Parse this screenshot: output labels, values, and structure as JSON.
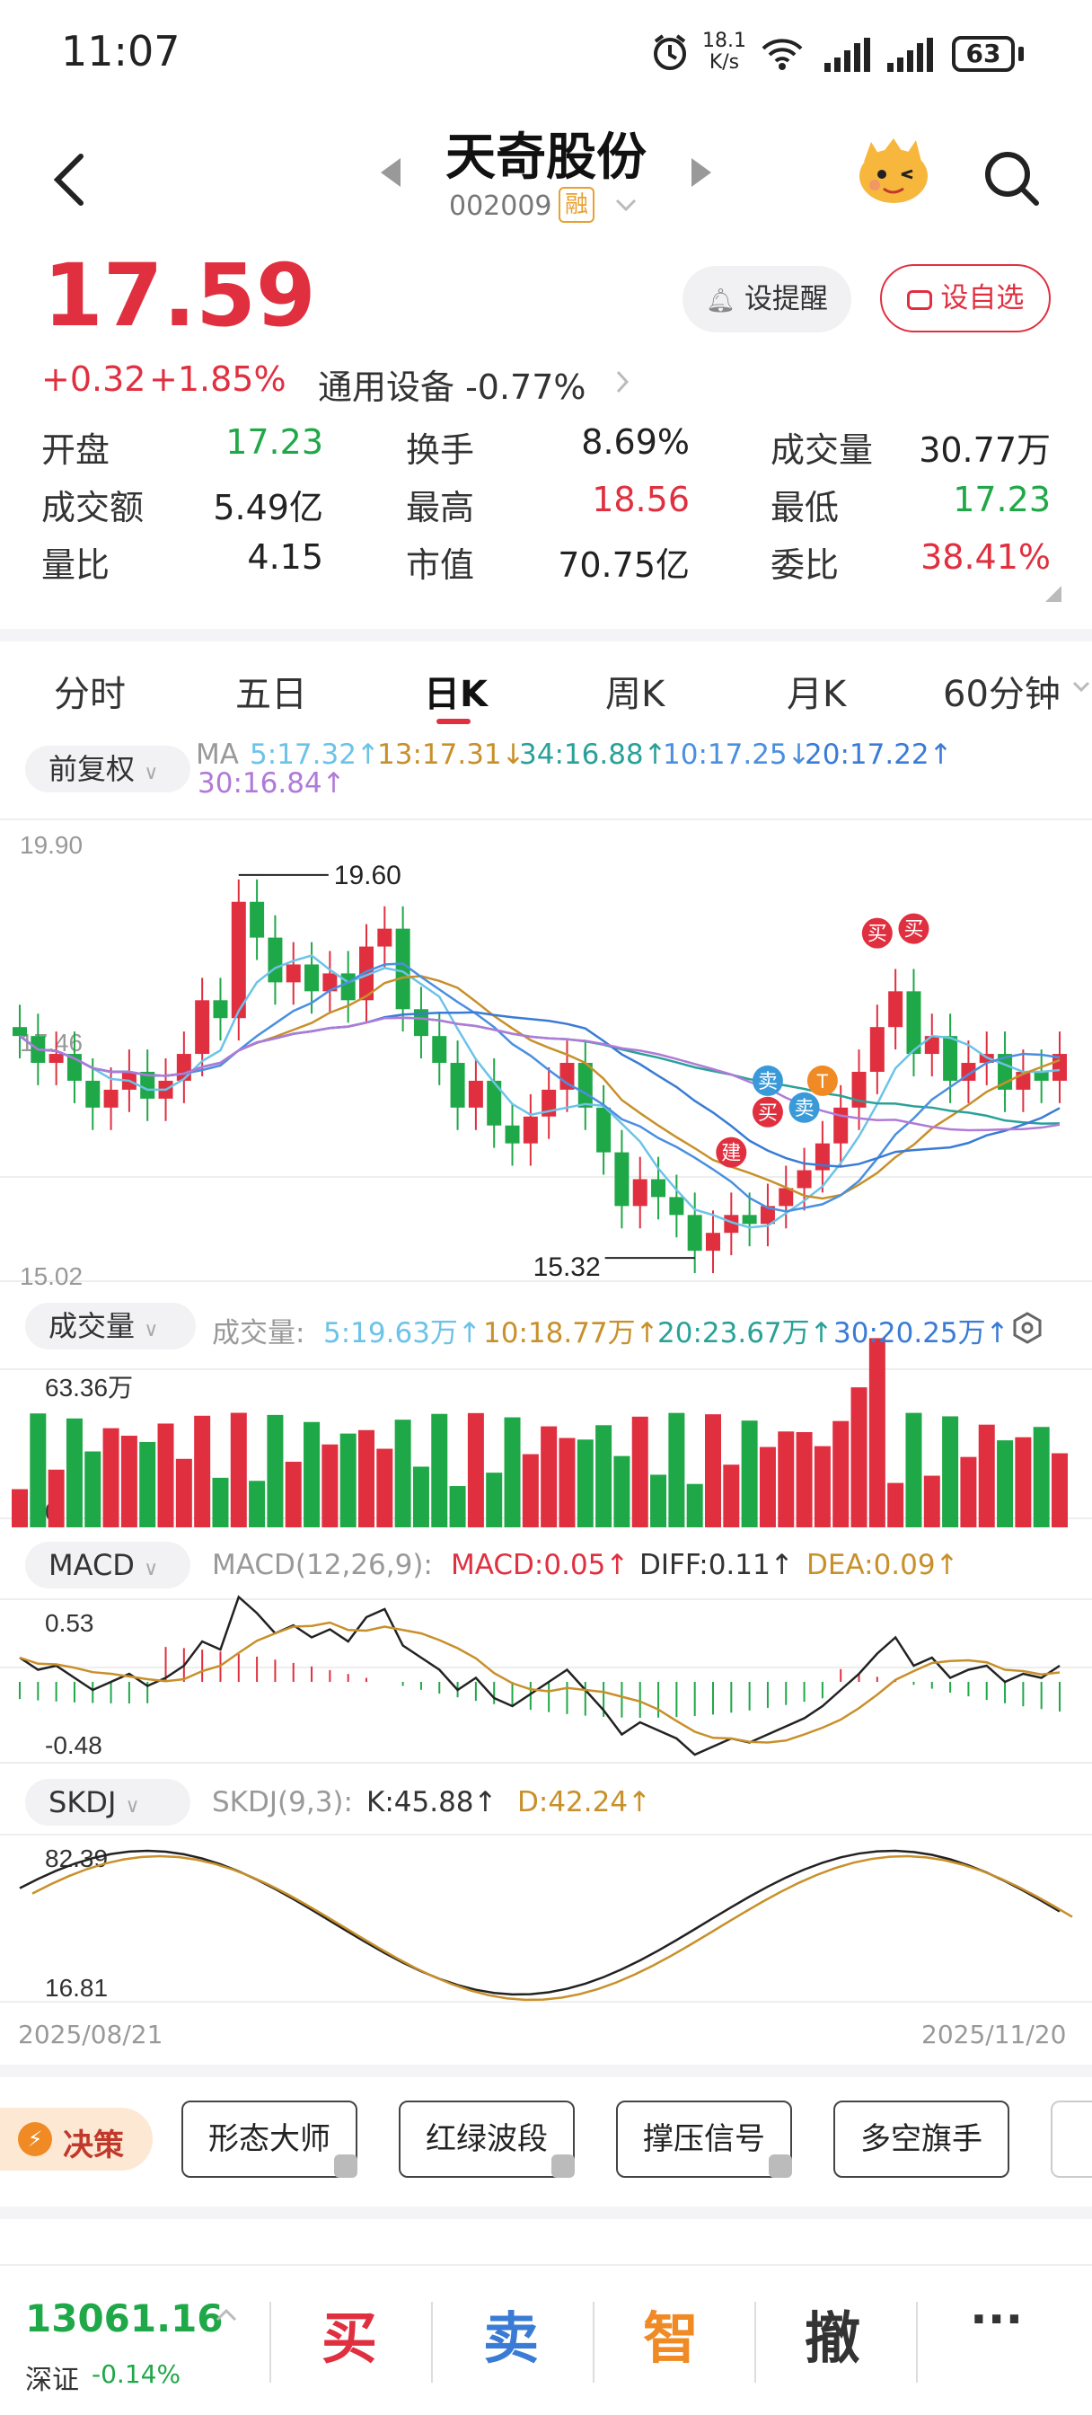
{
  "status": {
    "time": "11:07",
    "speed_top": "18.1",
    "speed_bot": "K/s",
    "battery": "63"
  },
  "header": {
    "title": "天奇股份",
    "code": "002009",
    "margin_tag": "融"
  },
  "quote": {
    "price": "17.59",
    "change": "+0.32",
    "change_pct": "+1.85%",
    "sector": "通用设备 -0.77%",
    "remind_btn": "设提醒",
    "watch_btn": "设自选",
    "stats": [
      {
        "label": "开盘",
        "value": "17.23",
        "color": "green"
      },
      {
        "label": "换手",
        "value": "8.69%",
        "color": "black"
      },
      {
        "label": "成交量",
        "value": "30.77万",
        "color": "black"
      },
      {
        "label": "成交额",
        "value": "5.49亿",
        "color": "black"
      },
      {
        "label": "最高",
        "value": "18.56",
        "color": "red"
      },
      {
        "label": "最低",
        "value": "17.23",
        "color": "green"
      },
      {
        "label": "量比",
        "value": "4.15",
        "color": "black"
      },
      {
        "label": "市值",
        "value": "70.75亿",
        "color": "black"
      },
      {
        "label": "委比",
        "value": "38.41%",
        "color": "red"
      }
    ]
  },
  "tabs": [
    "分时",
    "五日",
    "日K",
    "周K",
    "月K",
    "60分钟"
  ],
  "active_tab": "日K",
  "kline": {
    "adjust": "前复权",
    "ma_label": "MA",
    "ma": [
      {
        "text": "5:17.32↑",
        "color": "#6cc3e8"
      },
      {
        "text": "13:17.31↓",
        "color": "#c8902a"
      },
      {
        "text": "34:16.88↑",
        "color": "#2aa198"
      },
      {
        "text": "10:17.25↓",
        "color": "#4a8fe0"
      },
      {
        "text": "20:17.22↑",
        "color": "#3a7bd5"
      },
      {
        "text": "30:16.84↑",
        "color": "#b07ad8"
      }
    ],
    "y_top": "19.90",
    "y_mid": "17.46",
    "y_bot": "15.02",
    "high_label": "19.60",
    "low_label": "15.32",
    "marks": [
      {
        "t": "建",
        "c": "#e03040"
      },
      {
        "t": "买",
        "c": "#e03040"
      },
      {
        "t": "卖",
        "c": "#3a9ad9"
      },
      {
        "t": "卖",
        "c": "#3a9ad9"
      },
      {
        "t": "买",
        "c": "#e03040"
      },
      {
        "t": "买",
        "c": "#e03040"
      },
      {
        "t": "T",
        "c": "#f08a24"
      }
    ]
  },
  "volume": {
    "label": "成交量",
    "title": "成交量:",
    "ma": [
      {
        "text": "5:19.63万↑",
        "color": "#6cc3e8"
      },
      {
        "text": "10:18.77万↑",
        "color": "#c8902a"
      },
      {
        "text": "20:23.67万↑",
        "color": "#2aa198"
      },
      {
        "text": "30:20.25万↑",
        "color": "#3a7bd5"
      }
    ],
    "y_top": "63.36万",
    "y_bot": "0"
  },
  "macd": {
    "label": "MACD",
    "params": "MACD(12,26,9):",
    "macd": "MACD:0.05↑",
    "diff": "DIFF:0.11↑",
    "dea": "DEA:0.09↑",
    "y_top": "0.53",
    "y_bot": "-0.48"
  },
  "skdj": {
    "label": "SKDJ",
    "params": "SKDJ(9,3):",
    "k": "K:45.88↑",
    "d": "D:42.24↑",
    "y_top": "82.39",
    "y_bot": "16.81"
  },
  "dates": {
    "start": "2025/08/21",
    "end": "2025/11/20"
  },
  "decision": {
    "label": "决策",
    "buttons": [
      "形态大师",
      "红绿波段",
      "撑压信号",
      "多空旗手"
    ]
  },
  "bottom": {
    "index_value": "13061.16",
    "index_name": "深证",
    "index_change": "-0.14%",
    "buy": "买",
    "sell": "卖",
    "smart": "智",
    "cancel": "撤",
    "more": "···"
  },
  "colors": {
    "up": "#e03040",
    "down": "#1fa848"
  }
}
